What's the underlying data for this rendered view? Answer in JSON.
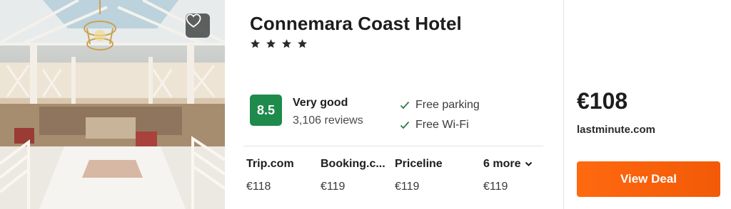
{
  "hotel": {
    "name": "Connemara Coast Hotel",
    "star_count": 4,
    "rating": {
      "score": "8.5",
      "label": "Very good",
      "reviews": "3,106 reviews",
      "badge_color": "#1e8a4c"
    },
    "amenities": [
      {
        "label": "Free parking",
        "icon": "check-icon"
      },
      {
        "label": "Free Wi-Fi",
        "icon": "check-icon"
      }
    ],
    "providers": [
      {
        "name": "Trip.com",
        "price": "€118"
      },
      {
        "name": "Booking.c...",
        "price": "€119"
      },
      {
        "name": "Priceline",
        "price": "€119"
      }
    ],
    "more": {
      "label": "6 more",
      "price": "€119",
      "icon": "chevron-down-icon"
    },
    "best_deal": {
      "price": "€108",
      "site": "lastminute.com",
      "button_label": "View Deal",
      "button_color": "#ff690f"
    },
    "favorite_icon": "heart-icon"
  }
}
